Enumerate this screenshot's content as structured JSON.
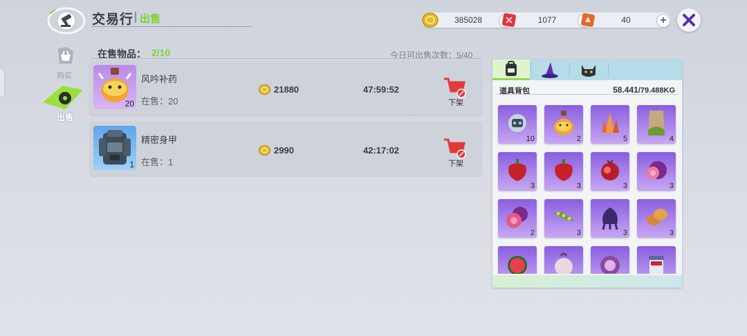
{
  "header": {
    "title": "交易行",
    "subtitle": "出售"
  },
  "currencies": [
    {
      "name": "gold-coin",
      "value": "385028",
      "color": "#e9b928"
    },
    {
      "name": "red-ticket",
      "value": "1077",
      "color": "#e0343f"
    },
    {
      "name": "orange-ticket",
      "value": "40",
      "color": "#e56a2a"
    }
  ],
  "nav": {
    "buy_label": "购买",
    "sell_label": "出售"
  },
  "listings": {
    "label": "在售物品：",
    "count": "2/10",
    "daily_limit": "今日可出售次数：5/40",
    "stock_label": "在售：",
    "unlist_label": "下架",
    "items": [
      {
        "name": "风吟补药",
        "qty": "20",
        "stock": "20",
        "price": "21880",
        "time_left": "47:59:52"
      },
      {
        "name": "精密身甲",
        "qty": "1",
        "stock": "1",
        "price": "2990",
        "time_left": "42:17:02"
      }
    ]
  },
  "backpack": {
    "label": "道具背包",
    "weight_current": "58.441",
    "weight_max": "/79.488KG",
    "tabs": [
      "backpack-icon",
      "wizard-hat-icon",
      "cat-icon"
    ],
    "items": [
      {
        "icon": "robot-crystal-icon",
        "count": "10"
      },
      {
        "icon": "potion-bottle-icon",
        "count": "2"
      },
      {
        "icon": "crystal-cluster-icon",
        "count": "5"
      },
      {
        "icon": "bark-plank-icon",
        "count": "4"
      },
      {
        "icon": "red-pepper-icon",
        "count": "3"
      },
      {
        "icon": "red-pepper-icon",
        "count": "3"
      },
      {
        "icon": "pomegranate-icon",
        "count": "3"
      },
      {
        "icon": "purple-fruit-icon",
        "count": "3"
      },
      {
        "icon": "cut-fruit-icon",
        "count": "2"
      },
      {
        "icon": "pea-pod-icon",
        "count": "3"
      },
      {
        "icon": "purple-squid-icon",
        "count": "3"
      },
      {
        "icon": "peanut-icon",
        "count": "3"
      },
      {
        "icon": "watermelon-icon",
        "count": ""
      },
      {
        "icon": "onion-icon",
        "count": ""
      },
      {
        "icon": "cabbage-icon",
        "count": ""
      },
      {
        "icon": "jam-jar-icon",
        "count": ""
      }
    ]
  }
}
